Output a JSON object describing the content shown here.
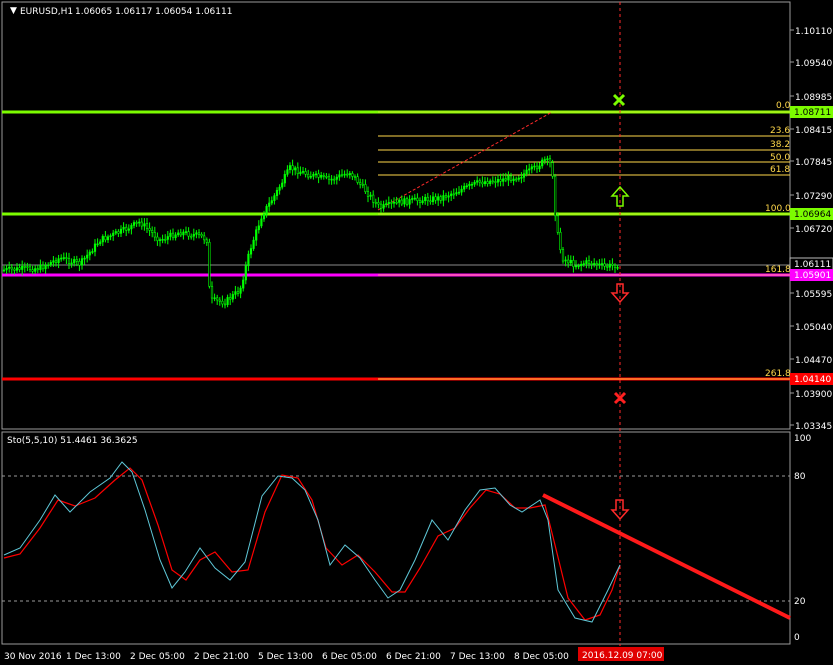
{
  "header": {
    "symbol_label": "EURUSD,H1",
    "ohlc": "1.06065 1.06117 1.06054 1.06111"
  },
  "price_axis": {
    "ticks": [
      "1.10110",
      "1.09540",
      "1.08985",
      "1.08415",
      "1.07845",
      "1.07290",
      "1.06720",
      "1.06111",
      "1.05595",
      "1.05040",
      "1.04470",
      "1.03900",
      "1.03345"
    ]
  },
  "levels": {
    "top_level_tag": "1.08711",
    "mid_level_tag": "1.06964",
    "current_price_tag": "1.06111",
    "magenta_level_tag": "1.05901",
    "red_level_tag": "1.04140"
  },
  "fibonacci": {
    "labels": [
      "0.0",
      "23.6",
      "38.2",
      "50.0",
      "61.8",
      "100.0",
      "161.8",
      "261.8"
    ]
  },
  "oscillator": {
    "title": "Sto(5,5,10) 51.4461 36.3625",
    "axis_ticks": [
      "100",
      "80",
      "20",
      "0"
    ]
  },
  "time_axis": {
    "labels": [
      "30 Nov 2016",
      "1 Dec 13:00",
      "2 Dec 05:00",
      "2 Dec 21:00",
      "5 Dec 13:00",
      "6 Dec 05:00",
      "6 Dec 21:00",
      "7 Dec 13:00",
      "8 Dec 05:00"
    ],
    "highlight_label": "2016.12.09 07:00"
  },
  "colors": {
    "background": "#000000",
    "bull_candle": "#00ff00",
    "level_green": "#7cfc00",
    "level_magenta": "#ff00ff",
    "level_red": "#ff0000",
    "stoch_main": "#5fc8d8",
    "stoch_signal": "#ff0000",
    "fib": "#ffd84a"
  },
  "markers": {
    "up_arrow": "up-arrow-icon",
    "down_arrow": "down-arrow-icon",
    "cross_green": "cross-icon",
    "cross_red": "cross-icon"
  }
}
